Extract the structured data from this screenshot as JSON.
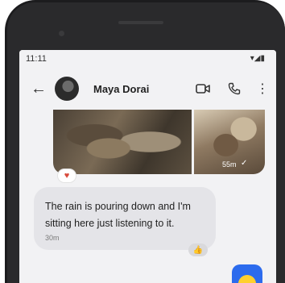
{
  "status_bar": {
    "time": "11:11",
    "icons": "▾◢▮"
  },
  "header": {
    "back_icon": "←",
    "contact_name": "Maya Dorai",
    "video_icon": "▭◁",
    "call_icon": "✆",
    "more_icon": "⋮"
  },
  "media_message": {
    "time": "55m",
    "status_icon": "✓",
    "reaction": "♥"
  },
  "text_message": {
    "text": "The rain is pouring down and I'm sitting here just listening to it.",
    "time": "30m",
    "reaction": "👍"
  },
  "colors": {
    "accent": "#2c6bed",
    "bubble": "#e4e4e8",
    "background": "#f2f2f4"
  }
}
